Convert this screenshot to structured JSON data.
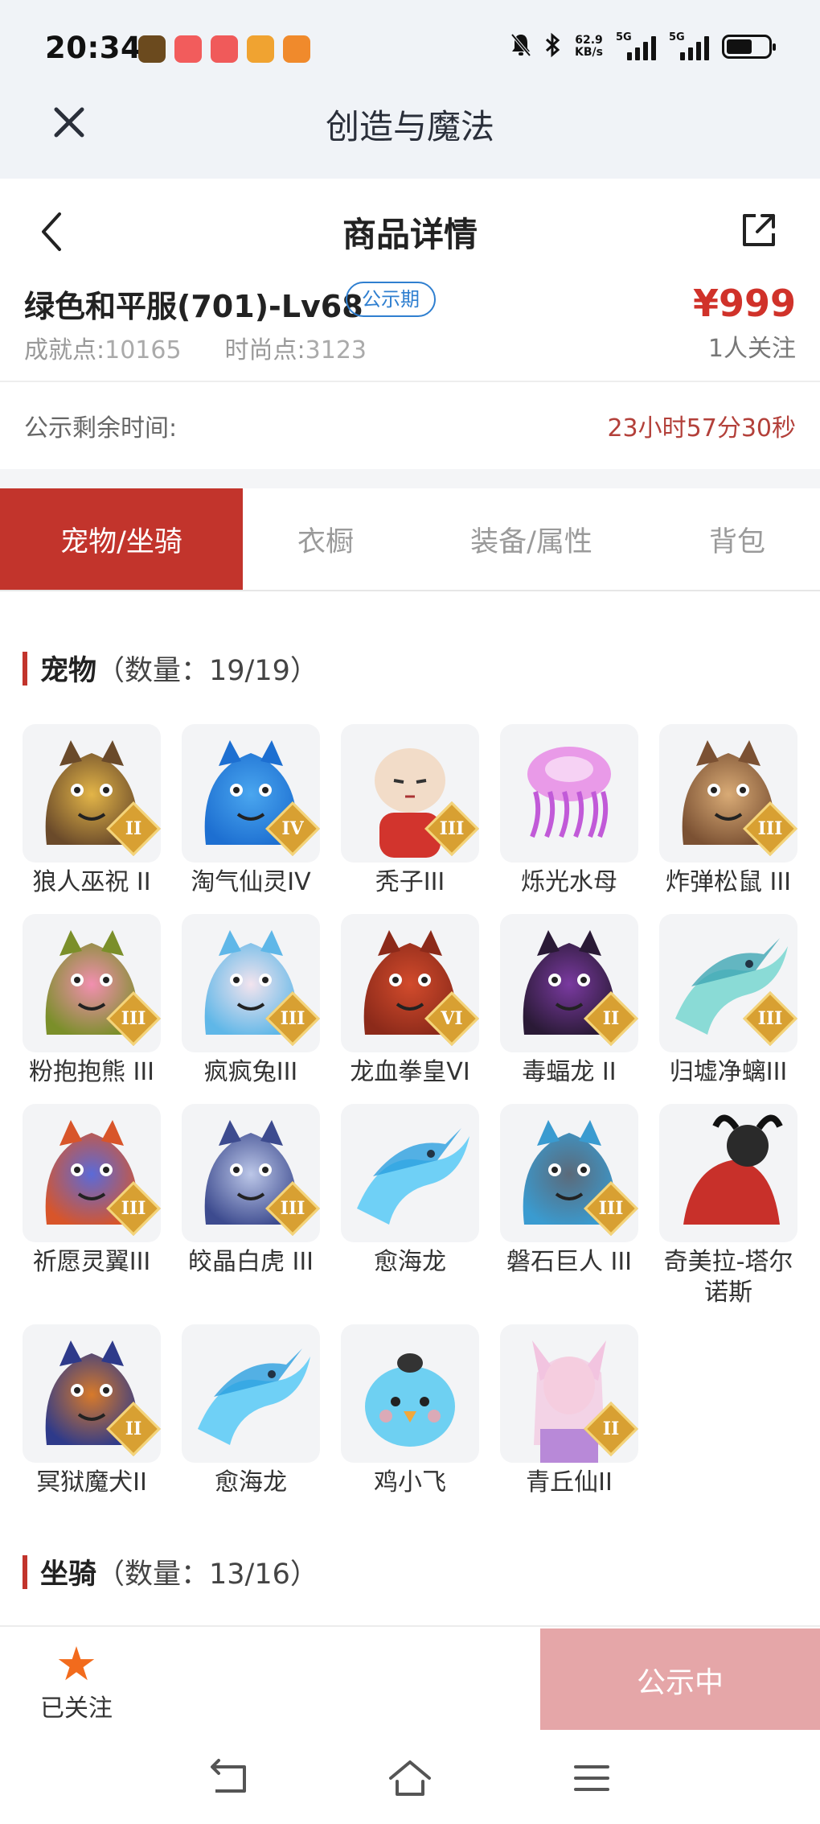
{
  "status_bar": {
    "time": "20:34",
    "net_speed_value": "62.9",
    "net_speed_unit": "KB/s",
    "network_tag_1": "5G",
    "network_tag_2": "5G",
    "app_icons": [
      {
        "icon": "game-app-icon",
        "color": "#6b4a1e"
      },
      {
        "icon": "douyin-app-icon",
        "color": "#f25c5c"
      },
      {
        "icon": "calendar-app-icon",
        "color": "#f05a5a"
      },
      {
        "icon": "weibo-app-icon",
        "color": "#f0a331"
      },
      {
        "icon": "bag-app-icon",
        "color": "#f08a2c"
      }
    ]
  },
  "title_bar": {
    "title": "创造与魔法"
  },
  "header": {
    "title": "商品详情"
  },
  "product": {
    "name": "绿色和平服(701)-Lv68",
    "badge": "公示期",
    "price": "¥999",
    "followers": "1人关注",
    "achievement_label": "成就点:",
    "achievement_value": "10165",
    "fashion_label": "时尚点:",
    "fashion_value": "3123"
  },
  "countdown": {
    "label": "公示剩余时间:",
    "value": "23小时57分30秒"
  },
  "tabs": [
    {
      "label": "宠物/坐骑",
      "active": true
    },
    {
      "label": "衣橱",
      "active": false
    },
    {
      "label": "装备/属性",
      "active": false
    },
    {
      "label": "背包",
      "active": false
    }
  ],
  "pets_section": {
    "title": "宠物",
    "count": "（数量：19/19）"
  },
  "pets": [
    {
      "name": "狼人巫祝 II",
      "rank": "II",
      "art": "werewolf",
      "c1": "#e3b548",
      "c2": "#6a4a2a"
    },
    {
      "name": "淘气仙灵IV",
      "rank": "IV",
      "art": "blue-dog",
      "c1": "#4aa6ef",
      "c2": "#1d6fd1"
    },
    {
      "name": "秃子III",
      "rank": "III",
      "art": "bald",
      "c1": "#f2dcc8",
      "c2": "#d2342d"
    },
    {
      "name": "烁光水母",
      "rank": "",
      "art": "jellyfish",
      "c1": "#e99ae8",
      "c2": "#c15ad8"
    },
    {
      "name": "炸弹松鼠 III",
      "rank": "III",
      "art": "squirrel",
      "c1": "#d9ab76",
      "c2": "#7b5133"
    },
    {
      "name": "粉抱抱熊 III",
      "rank": "III",
      "art": "pink-bear",
      "c1": "#f28fb0",
      "c2": "#7b8f2a"
    },
    {
      "name": "疯疯兔III",
      "rank": "III",
      "art": "rabbit",
      "c1": "#f3e4ee",
      "c2": "#5fb7e8"
    },
    {
      "name": "龙血拳皇VI",
      "rank": "VI",
      "art": "dragon-king",
      "c1": "#d24b2c",
      "c2": "#8c2a1a"
    },
    {
      "name": "毒蝠龙 II",
      "rank": "II",
      "art": "bat-dragon",
      "c1": "#7a3aa0",
      "c2": "#2a1a36"
    },
    {
      "name": "归墟净螭III",
      "rank": "III",
      "art": "sea-dragon",
      "c1": "#8adbd6",
      "c2": "#3fa6b4"
    },
    {
      "name": "祈愿灵翼III",
      "rank": "III",
      "art": "griffin",
      "c1": "#5b6ad8",
      "c2": "#d8552a"
    },
    {
      "name": "皎晶白虎 III",
      "rank": "III",
      "art": "white-tiger",
      "c1": "#bcc7e8",
      "c2": "#3d4b8f"
    },
    {
      "name": "愈海龙",
      "rank": "",
      "art": "water-dragon",
      "c1": "#6fd0f6",
      "c2": "#2a9fe0"
    },
    {
      "name": "磐石巨人 III",
      "rank": "III",
      "art": "golem",
      "c1": "#5b6a7a",
      "c2": "#3a9bd0"
    },
    {
      "name": "奇美拉-塔尔诺斯",
      "rank": "",
      "art": "chimera",
      "c1": "#c8302a",
      "c2": "#2a2a2a"
    },
    {
      "name": "冥狱魔犬II",
      "rank": "II",
      "art": "hellhound",
      "c1": "#d87a2a",
      "c2": "#2e3a8a"
    },
    {
      "name": "愈海龙",
      "rank": "",
      "art": "water-dragon",
      "c1": "#6fd0f6",
      "c2": "#2a9fe0"
    },
    {
      "name": "鸡小飞",
      "rank": "",
      "art": "chick",
      "c1": "#6ed0f2",
      "c2": "#f2a83a"
    },
    {
      "name": "青丘仙II",
      "rank": "II",
      "art": "fox-fairy",
      "c1": "#f2c4e0",
      "c2": "#b889d8"
    }
  ],
  "mounts_section": {
    "title": "坐骑",
    "count": "（数量：13/16）"
  },
  "bottom": {
    "follow_label": "已关注",
    "status_label": "公示中"
  }
}
